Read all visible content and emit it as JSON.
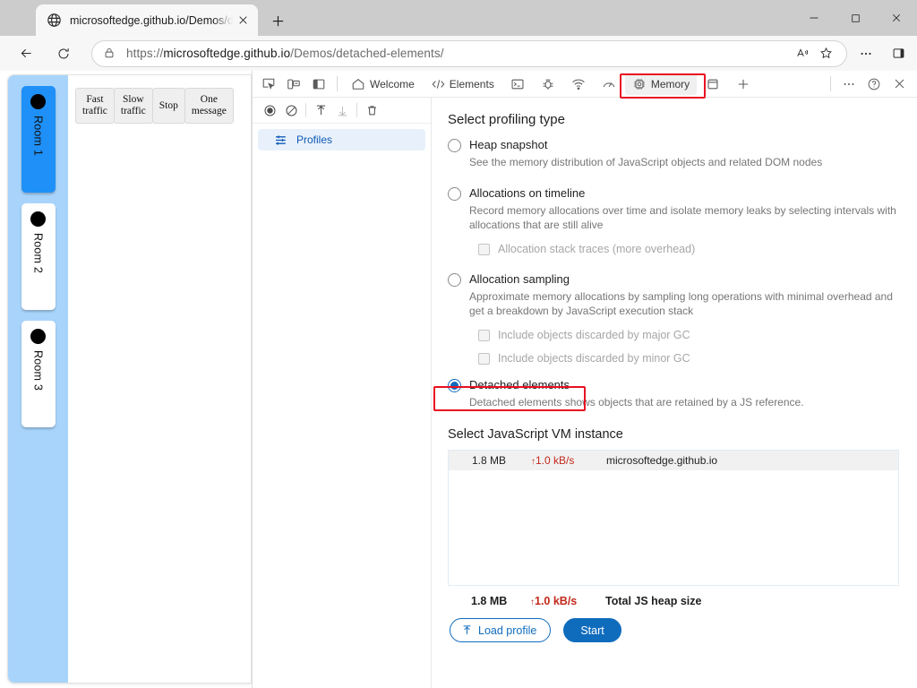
{
  "browser": {
    "tab": {
      "title": "microsoftedge.github.io/Demos/d",
      "favicon": "globe-icon",
      "close": "close-icon"
    },
    "new_tab_label": "+",
    "window_controls": {
      "minimize": "–",
      "maximize": "□",
      "close": "✕"
    },
    "address": {
      "url_prefix": "https://",
      "url_domain": "microsoftedge.github.io",
      "url_path": "/Demos/detached-elements/",
      "full_url": "https://microsoftedge.github.io/Demos/detached-elements/",
      "lock_icon": "lock-icon",
      "read_aloud_icon": "read-aloud-icon",
      "favorite_icon": "star-icon",
      "settings_icon": "ellipsis-icon",
      "sidebar_icon": "collections-icon"
    }
  },
  "page": {
    "rooms": [
      {
        "label": "Room 1",
        "active": true
      },
      {
        "label": "Room 2",
        "active": false
      },
      {
        "label": "Room 3",
        "active": false
      }
    ],
    "traffic_buttons": [
      {
        "label": "Fast\ntraffic"
      },
      {
        "label": "Slow\ntraffic"
      },
      {
        "label": "Stop"
      },
      {
        "label": "One\nmessage"
      }
    ]
  },
  "devtools": {
    "toolbar_icons": [
      {
        "name": "inspect-element-icon"
      },
      {
        "name": "device-emulation-icon"
      },
      {
        "name": "dock-side-icon"
      }
    ],
    "tabs": [
      {
        "label": "Welcome",
        "icon": "home-icon",
        "selected": false
      },
      {
        "label": "Elements",
        "icon": "code-icon",
        "selected": false
      },
      {
        "label": "",
        "icon": "console-icon",
        "selected": false
      },
      {
        "label": "",
        "icon": "sources-bug-icon",
        "selected": false
      },
      {
        "label": "",
        "icon": "network-icon",
        "selected": false
      },
      {
        "label": "",
        "icon": "performance-icon",
        "selected": false
      },
      {
        "label": "Memory",
        "icon": "memory-chip-icon",
        "selected": true
      },
      {
        "label": "",
        "icon": "application-icon",
        "selected": false
      },
      {
        "label": "",
        "icon": "more-tabs-plus-icon",
        "selected": false
      }
    ],
    "right_icons": [
      {
        "name": "more-options-icon"
      },
      {
        "name": "help-icon"
      },
      {
        "name": "close-devtools-icon"
      }
    ],
    "sidebar": {
      "toolbar": [
        {
          "name": "record-icon"
        },
        {
          "name": "clear-icon"
        },
        {
          "name": "load-profile-icon"
        },
        {
          "name": "save-profile-icon"
        },
        {
          "name": "delete-icon"
        }
      ],
      "item": {
        "label": "Profiles",
        "icon": "profiles-icon",
        "selected": true
      }
    },
    "main": {
      "profiling_heading": "Select profiling type",
      "options": [
        {
          "label": "Heap snapshot",
          "desc": "See the memory distribution of JavaScript objects and related DOM nodes",
          "checked": false
        },
        {
          "label": "Allocations on timeline",
          "desc": "Record memory allocations over time and isolate memory leaks by selecting intervals with allocations that are still alive",
          "checked": false,
          "sub": [
            {
              "label": "Allocation stack traces (more overhead)",
              "checked": false
            }
          ]
        },
        {
          "label": "Allocation sampling",
          "desc": "Approximate memory allocations by sampling long operations with minimal overhead and get a breakdown by JavaScript execution stack",
          "checked": false,
          "sub": [
            {
              "label": "Include objects discarded by major GC",
              "checked": false
            },
            {
              "label": "Include objects discarded by minor GC",
              "checked": false
            }
          ]
        },
        {
          "label": "Detached elements",
          "desc": "Detached elements shows objects that are retained by a JS reference.",
          "checked": true,
          "highlighted": true
        }
      ],
      "vm_heading": "Select JavaScript VM instance",
      "vm_rows": [
        {
          "size": "1.8 MB",
          "rate": "1.0 kB/s",
          "rate_arrow": "↑",
          "host": "microsoftedge.github.io"
        }
      ],
      "totals": {
        "size": "1.8 MB",
        "rate": "1.0 kB/s",
        "rate_arrow": "↑",
        "label": "Total JS heap size"
      },
      "buttons": {
        "load_profile": "Load profile",
        "load_profile_icon": "upload-arrow-icon",
        "start": "Start"
      }
    }
  },
  "annotations": {
    "highlight_color": "#e81123",
    "highlights": [
      {
        "target": "memory-tab",
        "color": "#e81123"
      },
      {
        "target": "detached-elements-radio",
        "color": "#e81123"
      }
    ]
  }
}
